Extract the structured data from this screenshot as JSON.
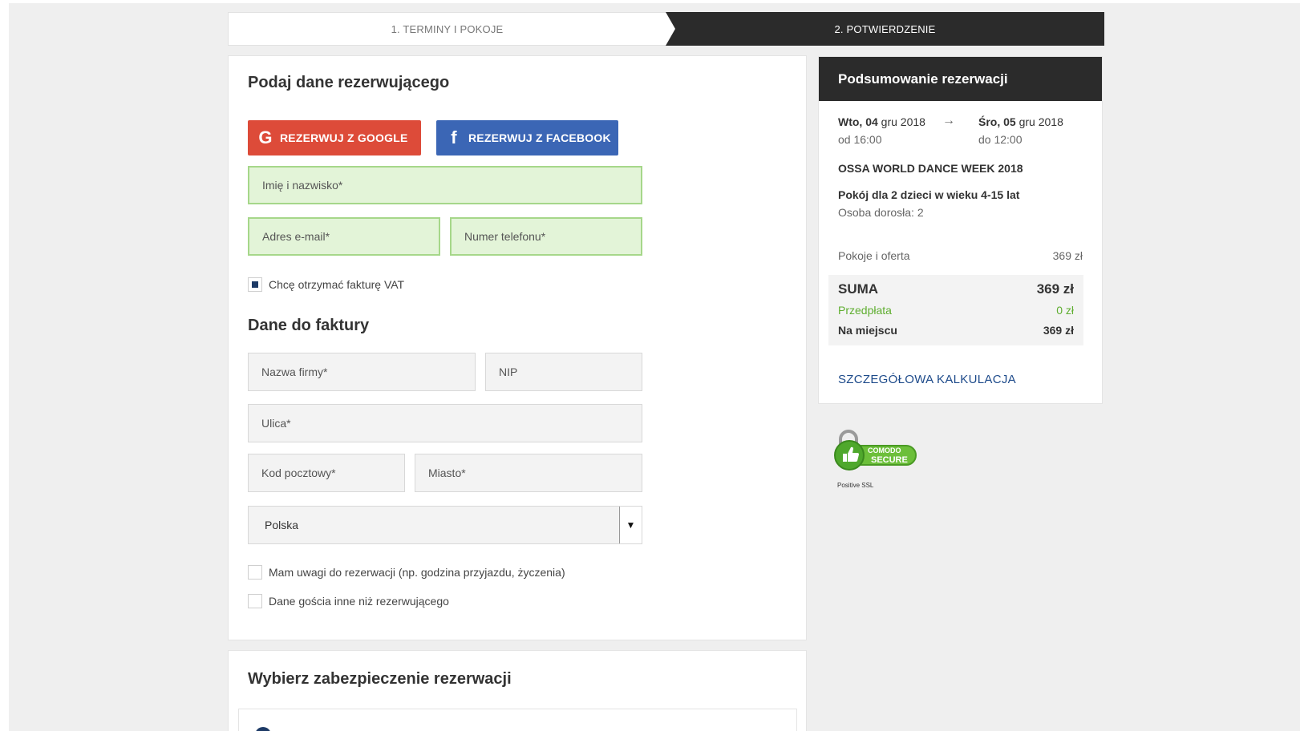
{
  "steps": {
    "step1": "1. TERMINY I POKOJE",
    "step2": "2. POTWIERDZENIE"
  },
  "booker": {
    "title": "Podaj dane rezerwującego",
    "google_btn": "REZERWUJ Z GOOGLE",
    "facebook_btn": "REZERWUJ Z FACEBOOK",
    "name_placeholder": "Imię i nazwisko*",
    "email_placeholder": "Adres e-mail*",
    "phone_placeholder": "Numer telefonu*",
    "vat_checkbox": "Chcę otrzymać fakturę VAT",
    "vat_checked": true
  },
  "invoice": {
    "title": "Dane do faktury",
    "company_placeholder": "Nazwa firmy*",
    "nip_placeholder": "NIP",
    "street_placeholder": "Ulica*",
    "postal_placeholder": "Kod pocztowy*",
    "city_placeholder": "Miasto*",
    "country_selected": "Polska"
  },
  "options": {
    "remarks_checkbox": "Mam uwagi do rezerwacji (np. godzina przyjazdu, życzenia)",
    "guest_checkbox": "Dane gościa inne niż rezerwującego"
  },
  "security": {
    "title": "Wybierz zabezpieczenie rezerwacji"
  },
  "summary": {
    "title": "Podsumowanie rezerwacji",
    "checkin_day": "Wto, 04",
    "checkin_month": "gru 2018",
    "checkin_time": "od 16:00",
    "arrow": "→",
    "checkout_day": "Śro, 05",
    "checkout_month": "gru 2018",
    "checkout_time": "do 12:00",
    "event": "OSSA WORLD DANCE WEEK 2018",
    "room": "Pokój dla 2 dzieci w wieku 4-15 lat",
    "adults": "Osoba dorosła: 2",
    "offer_label": "Pokoje i oferta",
    "offer_value": "369 zł",
    "sum_label": "SUMA",
    "sum_value": "369 zł",
    "prepay_label": "Przedpłata",
    "prepay_value": "0 zł",
    "onsite_label": "Na miejscu",
    "onsite_value": "369 zł",
    "details_link": "SZCZEGÓŁOWA KALKULACJA"
  },
  "badge": {
    "brand": "COMODO",
    "secure": "SECURE",
    "caption": "Positive SSL"
  },
  "colors": {
    "google": "#dd4b39",
    "facebook": "#3b66b5",
    "required_field_bg": "#e3f4d8",
    "prepay_green": "#5fae30"
  }
}
